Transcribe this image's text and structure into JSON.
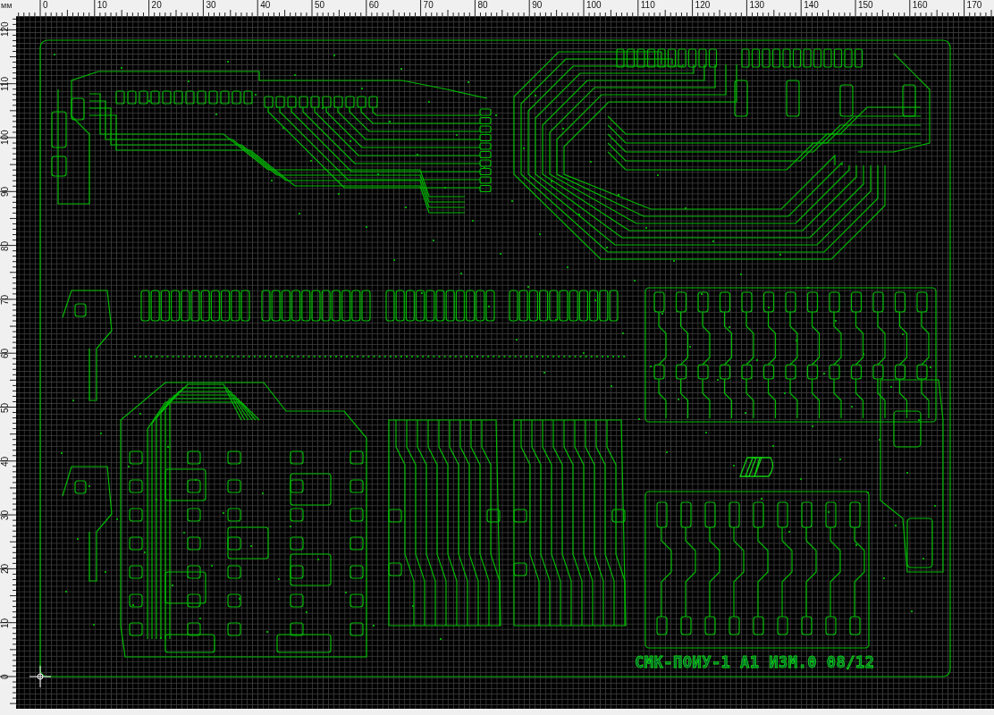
{
  "rulers": {
    "unit": "мм",
    "top": {
      "labels": [
        "0",
        "10",
        "20",
        "30",
        "40",
        "50",
        "60",
        "70",
        "80",
        "90",
        "100",
        "110",
        "120",
        "130",
        "140",
        "150",
        "160",
        "170"
      ]
    },
    "left": {
      "labels": [
        "120",
        "110",
        "100",
        "90",
        "80",
        "70",
        "60",
        "50",
        "40",
        "30",
        "20",
        "10",
        "0"
      ]
    }
  },
  "board": {
    "label": "СМК-ПОИУ-1 A1 ИЗМ.0 08/12"
  }
}
